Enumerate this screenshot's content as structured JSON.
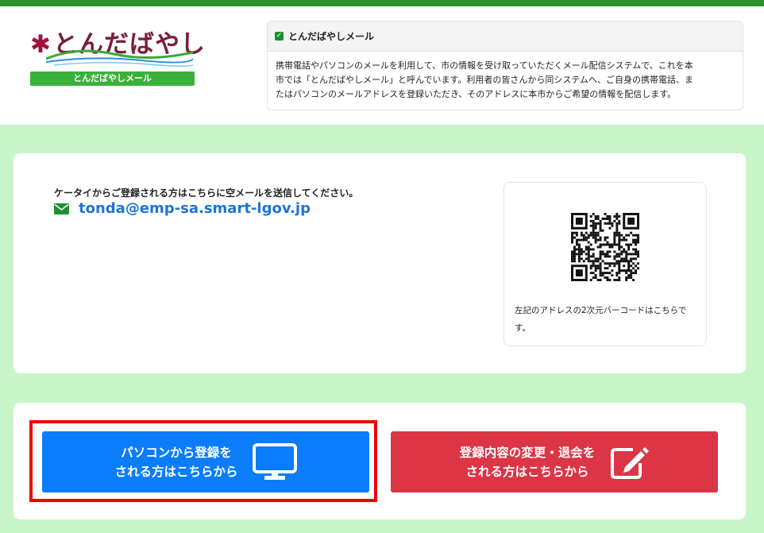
{
  "logo": {
    "title": "とんだばやし",
    "banner": "とんだばやしメール"
  },
  "info": {
    "heading": "とんだばやしメール",
    "lines": [
      "携帯電話やパソコンのメールを利用して、市の情報を受け取っていただくメール配信システムで、これを本",
      "市では「とんだばやしメール」と呼んでいます。利用者の皆さんから同システムへ、ご自身の携帯電話、ま",
      "たはパソコンのメールアドレスを登録いただき、そのアドレスに本市からご希望の情報を配信します。"
    ]
  },
  "mobile": {
    "instruction": "ケータイからご登録される方はこちらに空メールを送信してください。",
    "email": "tonda@emp-sa.smart-lgov.jp",
    "qr_caption_line1": "左記のアドレスの2次元バーコードはこちらで",
    "qr_caption_line2": "す。"
  },
  "buttons": {
    "pc_register_line1": "パソコンから登録を",
    "pc_register_line2": "される方はこちらから",
    "change_line1": "登録内容の変更・退会を",
    "change_line2": "される方はこちらから"
  },
  "colors": {
    "top_bar": "#2c8f2c",
    "background": "#c8f5c8",
    "primary_button": "#0b7dfb",
    "danger_button": "#dc3545",
    "highlight": "#ee0000",
    "link": "#1c74d8"
  },
  "icons": {
    "info_check": "checkbox-checked-icon",
    "email": "envelope-icon",
    "pc_button": "monitor-icon",
    "change_button": "edit-icon"
  }
}
